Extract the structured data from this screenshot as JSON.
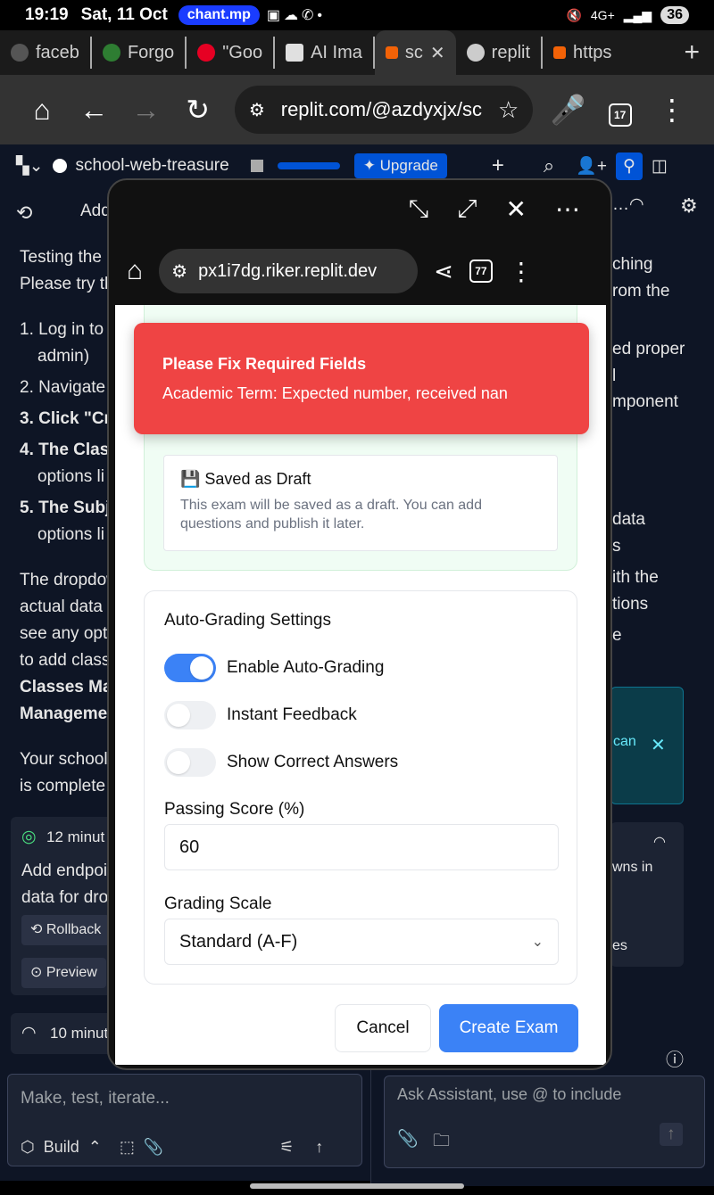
{
  "status_bar": {
    "time": "19:19",
    "date": "Sat, 11 Oct",
    "notification_pill": "chant.mp",
    "battery": "36",
    "network": "4G+"
  },
  "browser_tabs": [
    {
      "label": "faceb",
      "favicon_color": "#555555"
    },
    {
      "label": "Forgo",
      "favicon_color": "#2e7d32"
    },
    {
      "label": "\"Goo",
      "favicon_color": "#e60023"
    },
    {
      "label": "AI Ima",
      "favicon_color": "#e0e0e0"
    },
    {
      "label": "sc",
      "favicon_color": "#f26207",
      "active": true
    },
    {
      "label": "replit",
      "favicon_color": "#cccccc"
    },
    {
      "label": "https",
      "favicon_color": "#f26207"
    }
  ],
  "omnibox": {
    "url": "replit.com/@azdyxjx/sc",
    "tab_count": "17"
  },
  "replit": {
    "project_name": "school-web-treasure",
    "upgrade_label": "Upgrade",
    "left_header": "Add",
    "left_text": [
      "Testing the",
      "Please try th",
      "1. Log in to v",
      "admin)",
      "2. Navigate",
      "3. Click \"Cre",
      "4. The Class",
      "options li",
      "5. The Subje",
      "options li",
      "The dropdow",
      "actual data",
      "see any opti",
      "to add class",
      "Classes Ma",
      "Managemen",
      "Your school",
      "is complete"
    ],
    "checkpoint_time": "12 minut",
    "checkpoint_text_1": "Add endpoi",
    "checkpoint_text_2": "data for dro",
    "rollback_label": "Rollback",
    "preview_label": "Preview",
    "second_time": "10 minut",
    "chat_placeholder": "Make, test, iterate...",
    "build_label": "Build",
    "right_text": [
      "ching",
      "rom the",
      "ed proper",
      "l",
      "mponent",
      "data",
      "s",
      "ith the",
      "tions",
      "e",
      "can",
      "wns in",
      "es"
    ],
    "assistant_placeholder": "Ask Assistant, use @ to include"
  },
  "popup": {
    "url": "px1i7dg.riker.replit.dev",
    "tab_count": "77",
    "toast": {
      "title": "Please Fix Required Fields",
      "message": "Academic Term: Expected number, received nan"
    },
    "draft": {
      "title": "💾 Saved as Draft",
      "description": "This exam will be saved as a draft. You can add questions and publish it later."
    },
    "grading": {
      "title": "Auto-Grading Settings",
      "toggles": [
        {
          "label": "Enable Auto-Grading",
          "on": true
        },
        {
          "label": "Instant Feedback",
          "on": false
        },
        {
          "label": "Show Correct Answers",
          "on": false
        }
      ],
      "passing_label": "Passing Score (%)",
      "passing_value": "60",
      "scale_label": "Grading Scale",
      "scale_value": "Standard (A-F)"
    },
    "cancel_label": "Cancel",
    "create_label": "Create Exam"
  }
}
